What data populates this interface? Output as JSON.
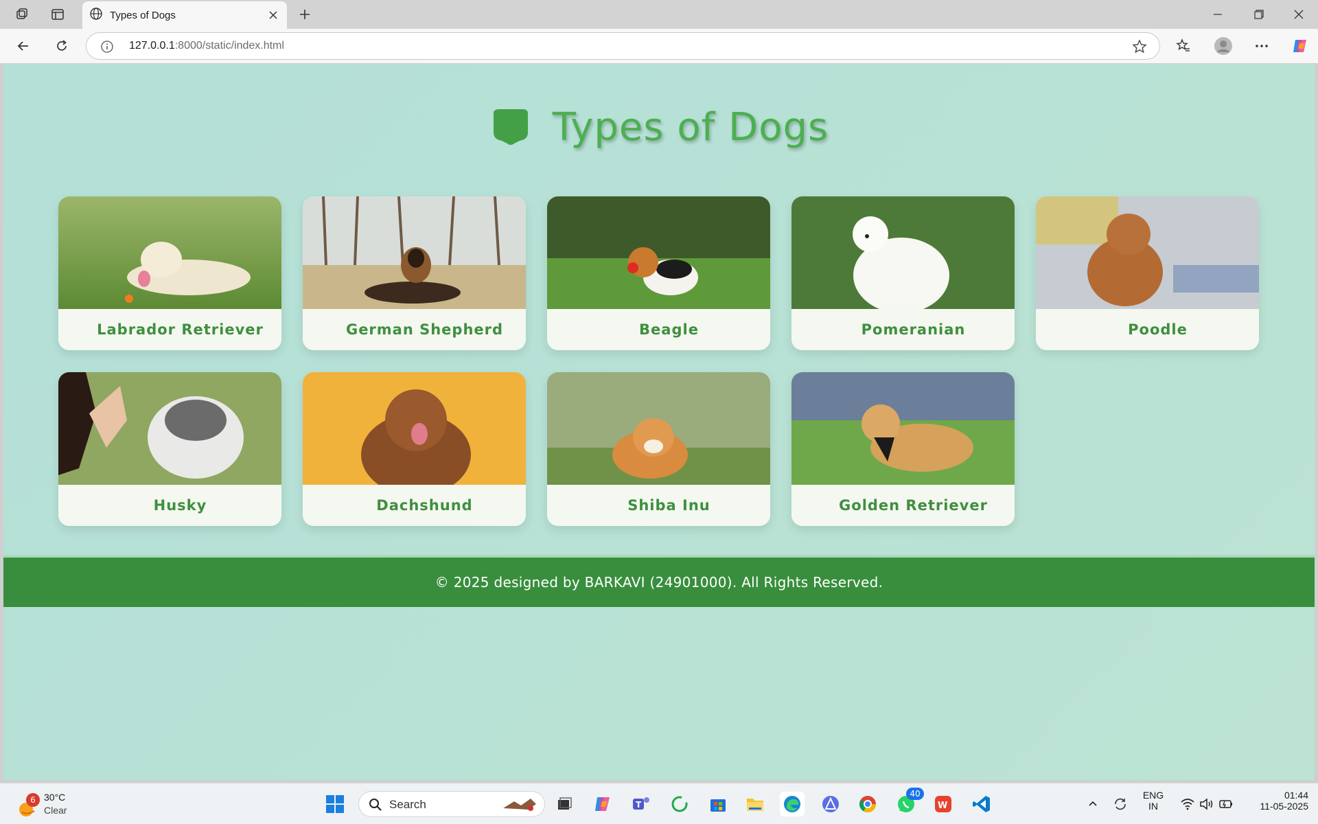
{
  "browser": {
    "tab_title": "Types of Dogs",
    "url_host": "127.0.0.1",
    "url_path": ":8000/static/index.html"
  },
  "page": {
    "title": "Types of Dogs",
    "breeds": [
      {
        "name": "Labrador Retriever"
      },
      {
        "name": "German Shepherd"
      },
      {
        "name": "Beagle"
      },
      {
        "name": "Pomeranian"
      },
      {
        "name": "Poodle"
      },
      {
        "name": "Husky"
      },
      {
        "name": "Dachshund"
      },
      {
        "name": "Shiba Inu"
      },
      {
        "name": "Golden Retriever"
      }
    ],
    "footer": "© 2025 designed by BARKAVI (24901000). All Rights Reserved."
  },
  "taskbar": {
    "weather_temp": "30°C",
    "weather_cond": "Clear",
    "weather_badge": "6",
    "search_placeholder": "Search",
    "whatsapp_badge": "40",
    "lang_top": "ENG",
    "lang_bottom": "IN",
    "time": "01:44",
    "date": "11-05-2025"
  },
  "colors": {
    "accent": "#4caf50",
    "footer_bg": "#388e3c",
    "page_bg": "#b4e0d8"
  }
}
